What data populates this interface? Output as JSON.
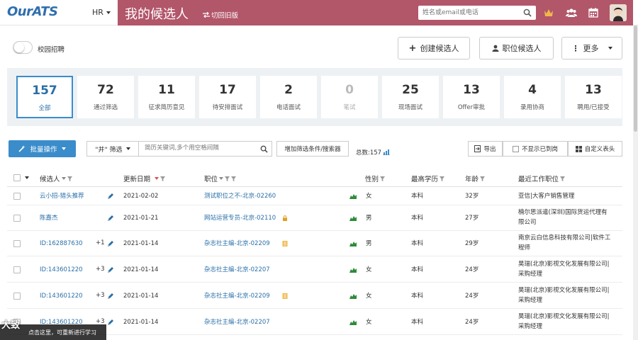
{
  "header": {
    "logo": "OurATS",
    "role": "HR",
    "title": "我的候选人",
    "switch_old": "切回旧版",
    "search_placeholder": "姓名或email或电话",
    "icons": [
      "crown-icon",
      "team-icon",
      "calendar-icon",
      "avatar"
    ]
  },
  "toolbar": {
    "campus_label": "校园招聘",
    "create_label": "创建候选人",
    "job_label": "职位候选人",
    "more_label": "更多"
  },
  "stats": [
    {
      "count": "157",
      "label": "全部",
      "active": true
    },
    {
      "count": "72",
      "label": "通过筛选"
    },
    {
      "count": "11",
      "label": "征求简历意见"
    },
    {
      "count": "17",
      "label": "待安排面试"
    },
    {
      "count": "2",
      "label": "电话面试"
    },
    {
      "count": "0",
      "label": "笔试",
      "muted": true
    },
    {
      "count": "25",
      "label": "现场面试"
    },
    {
      "count": "13",
      "label": "Offer审批"
    },
    {
      "count": "4",
      "label": "录用协商"
    },
    {
      "count": "13",
      "label": "聘用/已接受"
    }
  ],
  "filter": {
    "bulk_label": "批量操作",
    "filter_select": "\"并\" 筛选",
    "keyword_placeholder": "简历关键词,多个用空格间隔",
    "add_filter": "增加筛选条件/搜索器",
    "total": "总数:157",
    "export": "导出",
    "hide_arrived": "不显示已到岗",
    "custom_header": "自定义表头"
  },
  "columns": [
    "候选人",
    "更新日期",
    "职位",
    "性别",
    "最高学历",
    "年龄",
    "最近工作职位"
  ],
  "rows": [
    {
      "name": "云小招-猎头推荐",
      "plus": "",
      "date": "2021-02-02",
      "job": "测试职位之不-北京-02260",
      "job_icon": "",
      "gender": "女",
      "edu": "本科",
      "age": "32岁",
      "work": [
        "亚信|大客户销售管理"
      ]
    },
    {
      "name": "陈嘉杰",
      "plus": "",
      "date": "2021-01-21",
      "job": "网站运营专员-北京-02110",
      "job_icon": "lock",
      "gender": "男",
      "edu": "本科",
      "age": "27岁",
      "work": [
        "楠尔思派遣(深圳)国际货运代理有",
        "限公司"
      ]
    },
    {
      "name": "ID:162887630",
      "plus": "+1",
      "date": "2021-01-14",
      "job": "杂志社主编-北京-02209",
      "job_icon": "doc",
      "gender": "男",
      "edu": "本科",
      "age": "29岁",
      "work": [
        "南京云白信息科技有限公司|软件工",
        "程师"
      ]
    },
    {
      "name": "ID:143601220",
      "plus": "+3",
      "date": "2021-01-14",
      "job": "杂志社主编-北京-02207",
      "job_icon": "",
      "gender": "女",
      "edu": "本科",
      "age": "24岁",
      "work": [
        "昊瑞(北京)影视文化发展有限公司|",
        "采购经理"
      ]
    },
    {
      "name": "ID:143601220",
      "plus": "+3",
      "date": "2021-01-14",
      "job": "杂志社主编-北京-02209",
      "job_icon": "doc",
      "gender": "女",
      "edu": "本科",
      "age": "24岁",
      "work": [
        "昊瑞(北京)影视文化发展有限公司|",
        "采购经理"
      ]
    },
    {
      "name": "ID:143601220",
      "plus": "+3",
      "date": "2021-01-14",
      "job": "杂志社主编-北京-02207",
      "job_icon": "",
      "gender": "女",
      "edu": "本科",
      "age": "24岁",
      "work": [
        "昊瑞(北京)影视文化发展有限公司|",
        "采购经理"
      ]
    }
  ],
  "overlay": {
    "tip": "点击这里，可重新进行学习",
    "mark": "大致"
  },
  "colors": {
    "brand_band": "#b2566a",
    "accent_blue": "#3a8ccb",
    "link_blue": "#2a6fa8",
    "chart_green": "#2e8b3a",
    "stats_bg": "#eef1f4"
  }
}
